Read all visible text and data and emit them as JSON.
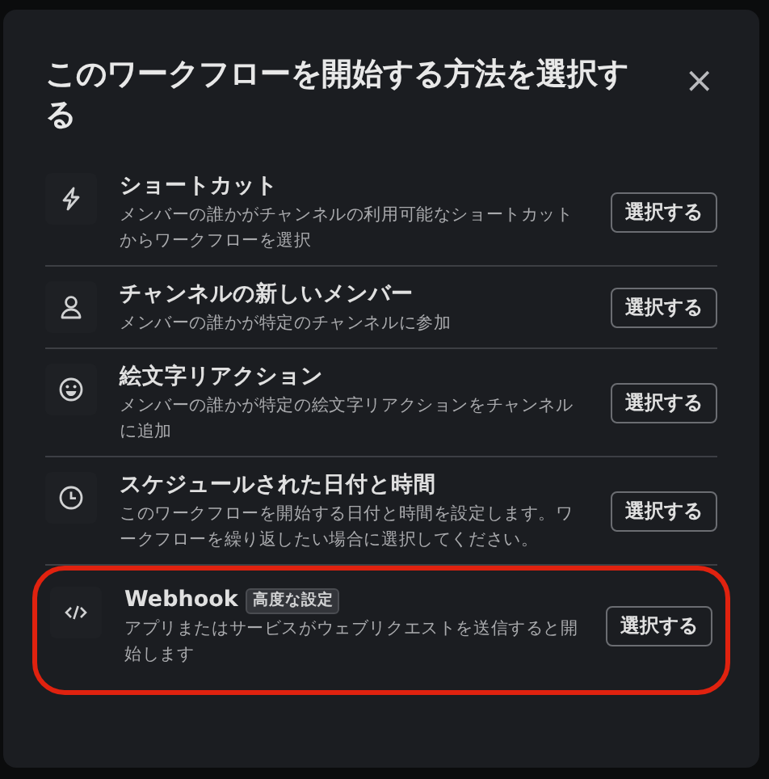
{
  "dialog": {
    "title": "このワークフローを開始する方法を選択する",
    "close": "×"
  },
  "options": [
    {
      "kind": "shortcut",
      "title": "ショートカット",
      "description": "メンバーの誰かがチャンネルの利用可能なショートカットからワークフローを選択",
      "button": "選択する",
      "highlighted": false
    },
    {
      "kind": "member",
      "title": "チャンネルの新しいメンバー",
      "description": "メンバーの誰かが特定のチャンネルに参加",
      "button": "選択する",
      "highlighted": false
    },
    {
      "kind": "emoji",
      "title": "絵文字リアクション",
      "description": "メンバーの誰かが特定の絵文字リアクションをチャンネルに追加",
      "button": "選択する",
      "highlighted": false
    },
    {
      "kind": "schedule",
      "title": "スケジュールされた日付と時間",
      "description": "このワークフローを開始する日付と時間を設定します。ワークフローを繰り返したい場合に選択してください。",
      "button": "選択する",
      "highlighted": false
    },
    {
      "kind": "webhook",
      "title": "Webhook",
      "badge": "高度な設定",
      "description": "アプリまたはサービスがウェブリクエストを送信すると開始します",
      "button": "選択する",
      "highlighted": true
    }
  ]
}
